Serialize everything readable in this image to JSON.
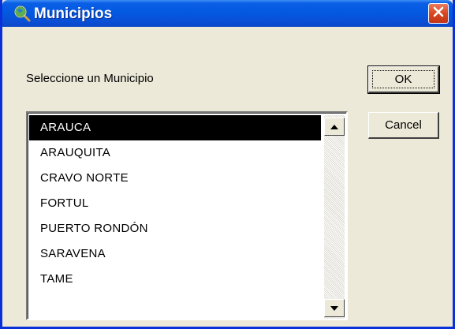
{
  "window": {
    "title": "Municipios",
    "app_icon": "globe-magnifier-icon",
    "close_icon": "close-icon"
  },
  "dialog": {
    "prompt": "Seleccione un Municipio",
    "ok_label": "OK",
    "cancel_label": "Cancel"
  },
  "list": {
    "selected": "ARAUCA",
    "items": [
      "ARAUCA",
      "ARAUQUITA",
      "CRAVO NORTE",
      "FORTUL",
      "PUERTO RONDÓN",
      "SARAVENA",
      "TAME"
    ]
  },
  "colors": {
    "title_bar": "#0358e0",
    "close_button": "#d9461f",
    "selection": "#000000",
    "dialog_bg": "#ece9d8"
  }
}
